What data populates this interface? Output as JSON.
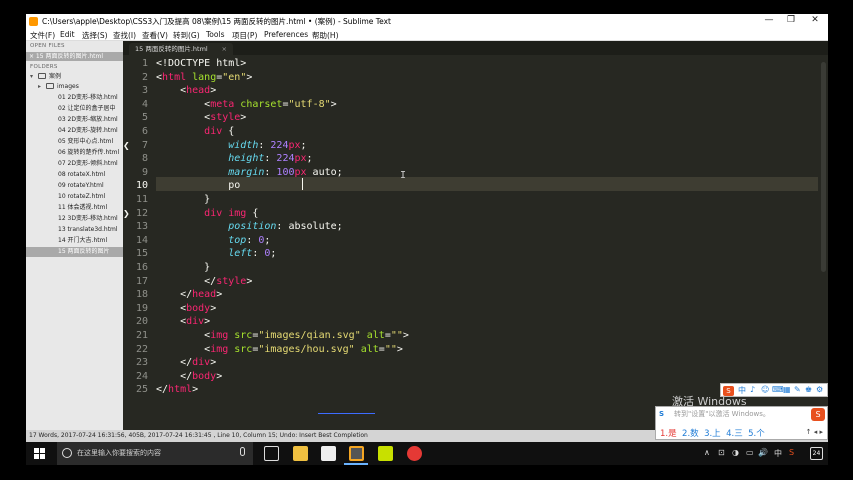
{
  "window": {
    "title": "C:\\Users\\apple\\Desktop\\CSS3入门及提高 08\\案例\\15 两面反转的图片.html • (案例) - Sublime Text",
    "controls": [
      "—",
      "❐",
      "✕"
    ]
  },
  "menu": [
    "文件(F)",
    "Edit",
    "选择(S)",
    "查找(I)",
    "查看(V)",
    "转到(G)",
    "Tools",
    "项目(P)",
    "Preferences",
    "帮助(H)"
  ],
  "sidebar": {
    "open_files_label": "OPEN FILES",
    "open_file": "× 15 两面反转的图片.html",
    "folders_label": "FOLDERS",
    "root": "案例",
    "subfolder": "images",
    "files": [
      "01 2D变形-移动.html",
      "02 让定位的盒子居中",
      "03 2D变形-缩放.html",
      "04 2D变形-旋转.html",
      "05 变形中心点.html",
      "06 旋转的楚乔传.html",
      "07 2D变形-倾斜.html",
      "08 rotateX.html",
      "09 rotateY.html",
      "10 rotateZ.html",
      "11 体会透视.html",
      "12 3D变形-移动.html",
      "13 translate3d.html",
      "14 开门大吉.html",
      "15 两面反转的图片"
    ]
  },
  "tab": {
    "label": "15 两面反转的图片.html",
    "close": "×"
  },
  "editor": {
    "line_numbers": [
      "1",
      "2",
      "3",
      "4",
      "5",
      "6",
      "7",
      "8",
      "9",
      "10",
      "11",
      "12",
      "13",
      "14",
      "15",
      "16",
      "17",
      "18",
      "19",
      "20",
      "21",
      "22",
      "23",
      "24",
      "25"
    ],
    "lines": [
      [
        [
          "t-plain",
          "<!DOCTYPE html>"
        ]
      ],
      [
        [
          "t-plain",
          "<"
        ],
        [
          "t-tag",
          "html"
        ],
        [
          "t-attr",
          " lang"
        ],
        [
          "t-plain",
          "="
        ],
        [
          "t-str",
          "\"en\""
        ],
        [
          "t-plain",
          ">"
        ]
      ],
      [
        [
          "t-plain",
          "    <"
        ],
        [
          "t-tag",
          "head"
        ],
        [
          "t-plain",
          ">"
        ]
      ],
      [
        [
          "t-plain",
          "        <"
        ],
        [
          "t-tag",
          "meta"
        ],
        [
          "t-attr",
          " charset"
        ],
        [
          "t-plain",
          "="
        ],
        [
          "t-str",
          "\"utf-8\""
        ],
        [
          "t-plain",
          ">"
        ]
      ],
      [
        [
          "t-plain",
          "        <"
        ],
        [
          "t-tag",
          "style"
        ],
        [
          "t-plain",
          ">"
        ]
      ],
      [
        [
          "t-plain",
          "        "
        ],
        [
          "t-tag",
          "div"
        ],
        [
          "t-plain",
          " {"
        ]
      ],
      [
        [
          "t-plain",
          "            "
        ],
        [
          "t-prop",
          "width"
        ],
        [
          "t-plain",
          ": "
        ],
        [
          "t-num",
          "224"
        ],
        [
          "t-tag",
          "px"
        ],
        [
          "t-plain",
          ";"
        ]
      ],
      [
        [
          "t-plain",
          "            "
        ],
        [
          "t-prop",
          "height"
        ],
        [
          "t-plain",
          ": "
        ],
        [
          "t-num",
          "224"
        ],
        [
          "t-tag",
          "px"
        ],
        [
          "t-plain",
          ";"
        ]
      ],
      [
        [
          "t-plain",
          "            "
        ],
        [
          "t-prop",
          "margin"
        ],
        [
          "t-plain",
          ": "
        ],
        [
          "t-num",
          "100"
        ],
        [
          "t-tag",
          "px"
        ],
        [
          "t-plain",
          " auto;"
        ]
      ],
      [
        [
          "t-plain",
          "            po"
        ]
      ],
      [
        [
          "t-plain",
          "        }"
        ]
      ],
      [
        [
          "t-plain",
          "        "
        ],
        [
          "t-tag",
          "div"
        ],
        [
          "t-plain",
          " "
        ],
        [
          "t-tag",
          "img"
        ],
        [
          "t-plain",
          " {"
        ]
      ],
      [
        [
          "t-plain",
          "            "
        ],
        [
          "t-prop",
          "position"
        ],
        [
          "t-plain",
          ": absolute;"
        ]
      ],
      [
        [
          "t-plain",
          "            "
        ],
        [
          "t-prop",
          "top"
        ],
        [
          "t-plain",
          ": "
        ],
        [
          "t-num",
          "0"
        ],
        [
          "t-plain",
          ";"
        ]
      ],
      [
        [
          "t-plain",
          "            "
        ],
        [
          "t-prop",
          "left"
        ],
        [
          "t-plain",
          ": "
        ],
        [
          "t-num",
          "0"
        ],
        [
          "t-plain",
          ";"
        ]
      ],
      [
        [
          "t-plain",
          "        }"
        ]
      ],
      [
        [
          "t-plain",
          "        </"
        ],
        [
          "t-tag",
          "style"
        ],
        [
          "t-plain",
          ">"
        ]
      ],
      [
        [
          "t-plain",
          "    </"
        ],
        [
          "t-tag",
          "head"
        ],
        [
          "t-plain",
          ">"
        ]
      ],
      [
        [
          "t-plain",
          "    <"
        ],
        [
          "t-tag",
          "body"
        ],
        [
          "t-plain",
          ">"
        ]
      ],
      [
        [
          "t-plain",
          "    <"
        ],
        [
          "t-tag",
          "div"
        ],
        [
          "t-plain",
          ">"
        ]
      ],
      [
        [
          "t-plain",
          "        <"
        ],
        [
          "t-tag",
          "img"
        ],
        [
          "t-attr",
          " src"
        ],
        [
          "t-plain",
          "="
        ],
        [
          "t-str",
          "\"images/qian.svg\""
        ],
        [
          "t-attr",
          " alt"
        ],
        [
          "t-plain",
          "="
        ],
        [
          "t-str",
          "\"\""
        ],
        [
          "t-plain",
          ">"
        ]
      ],
      [
        [
          "t-plain",
          "        <"
        ],
        [
          "t-tag",
          "img"
        ],
        [
          "t-attr",
          " src"
        ],
        [
          "t-plain",
          "="
        ],
        [
          "t-str",
          "\"images/hou.svg\""
        ],
        [
          "t-attr",
          " alt"
        ],
        [
          "t-plain",
          "="
        ],
        [
          "t-str",
          "\"\""
        ],
        [
          "t-plain",
          ">"
        ]
      ],
      [
        [
          "t-plain",
          "    </"
        ],
        [
          "t-tag",
          "div"
        ],
        [
          "t-plain",
          ">"
        ]
      ],
      [
        [
          "t-plain",
          "    </"
        ],
        [
          "t-tag",
          "body"
        ],
        [
          "t-plain",
          ">"
        ]
      ],
      [
        [
          "t-plain",
          "</"
        ],
        [
          "t-tag",
          "html"
        ],
        [
          "t-plain",
          ">"
        ]
      ]
    ]
  },
  "status": "17 Words, 2017-07-24 16:31:56, 405B, 2017-07-24 16:31:45 , Line 10, Column 15; Undo: Insert Best Completion",
  "watermark": "激活 Windows",
  "ime": {
    "bar": [
      "中",
      "♪",
      "☺",
      "⌨",
      "▦",
      "✎",
      "♚",
      "⚙"
    ],
    "input_hint": "转到\"设置\"以激活 Windows。",
    "candidates": [
      "1.是",
      "2.数",
      "3.上",
      "4.三",
      "5.个"
    ],
    "arrows": "↑ ◂ ▸"
  },
  "taskbar": {
    "search_placeholder": "在这里输入你要搜索的内容",
    "tray": [
      "∧",
      "⊡",
      "◑",
      "▭",
      "🔊",
      "中",
      "S"
    ],
    "notification_count": "24"
  }
}
